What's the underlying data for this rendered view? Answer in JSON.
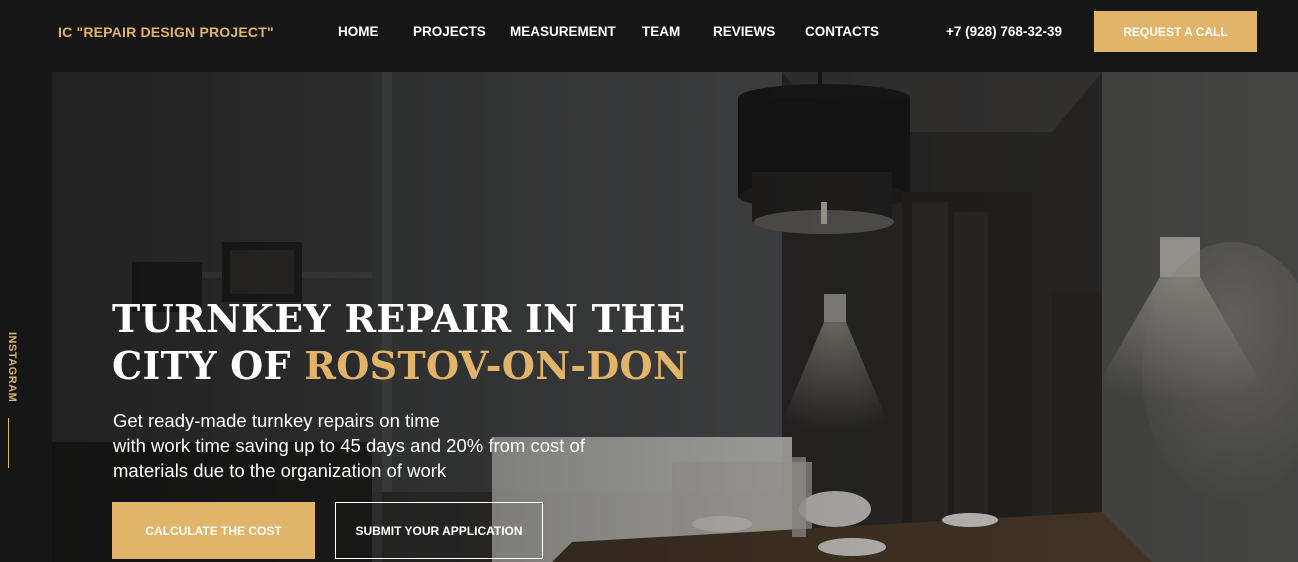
{
  "header": {
    "logo": "IC \"REPAIR DESIGN PROJECT\"",
    "nav": [
      "HOME",
      "PROJECTS",
      "MEASUREMENT",
      "TEAM",
      "REVIEWS",
      "CONTACTS"
    ],
    "phone": "+7 (928) 768-32-39",
    "request_call": "REQUEST A CALL"
  },
  "side": {
    "instagram": "INSTAGRAM"
  },
  "hero": {
    "title_line1": "TURNKEY REPAIR IN THE",
    "title_line2_prefix": "CITY OF ",
    "title_line2_accent": "ROSTOV-ON-DON",
    "subtitle_lines": [
      "Get ready-made turnkey repairs on time",
      "with work time saving up to 45 days and 20% from cost of",
      "materials due to the organization of work"
    ],
    "calculate_button": "CALCULATE THE COST",
    "submit_button": "SUBMIT YOUR APPLICATION"
  },
  "colors": {
    "accent": "#e1b46a",
    "background": "#161616",
    "text": "#ffffff"
  }
}
